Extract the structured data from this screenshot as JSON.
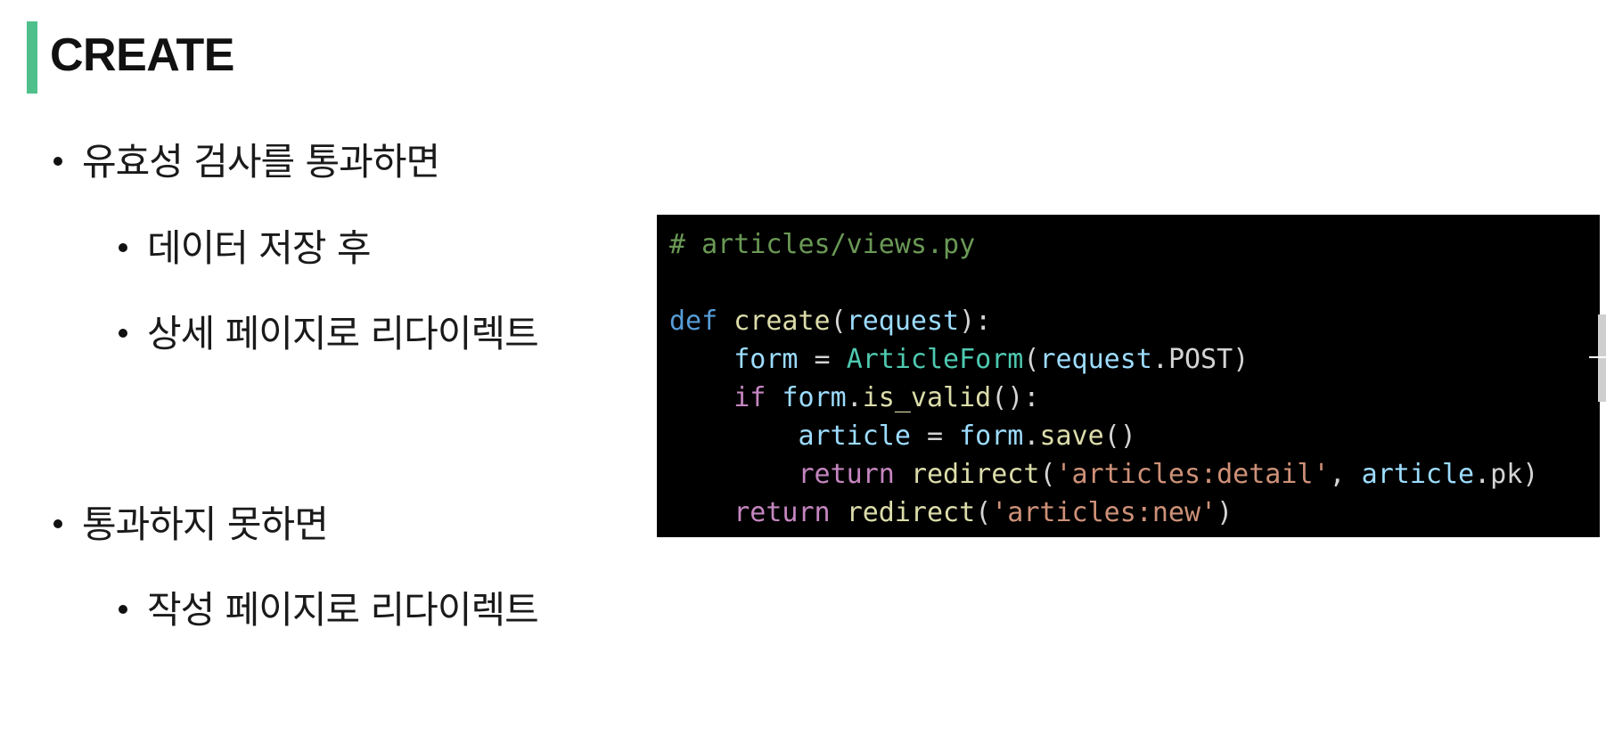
{
  "slide": {
    "title": "CREATE",
    "accent_color": "#4fbf8c"
  },
  "bullets": [
    {
      "level": 1,
      "text": "유효성 검사를 통과하면"
    },
    {
      "level": 2,
      "text": "데이터 저장 후"
    },
    {
      "level": 2,
      "text": "상세 페이지로 리다이렉트"
    },
    {
      "level": 1,
      "text": "통과하지 못하면"
    },
    {
      "level": 2,
      "text": "작성 페이지로 리다이렉트"
    }
  ],
  "code": {
    "background": "#000000",
    "line1": {
      "comment": "# articles/views.py"
    },
    "line3": {
      "kw_def": "def",
      "fn": "create",
      "p1": "(",
      "arg": "request",
      "p2": "):"
    },
    "line4": {
      "indent": "    ",
      "var": "form",
      "op": " = ",
      "cls": "ArticleForm",
      "p1": "(",
      "arg": "request",
      "dot": ".",
      "attr": "POST",
      "p2": ")"
    },
    "line5": {
      "indent": "    ",
      "kw": "if",
      "sp": " ",
      "var": "form",
      "dot": ".",
      "fn": "is_valid",
      "p": "():"
    },
    "line6": {
      "indent": "        ",
      "var": "article",
      "op": " = ",
      "obj": "form",
      "dot": ".",
      "fn": "save",
      "p": "()"
    },
    "line7": {
      "indent": "        ",
      "kw": "return",
      "sp": " ",
      "fn": "redirect",
      "p1": "(",
      "str": "'articles:detail'",
      "comma": ", ",
      "var": "article",
      "dot": ".",
      "attr": "pk",
      "p2": ")"
    },
    "line8": {
      "indent": "    ",
      "kw": "return",
      "sp": " ",
      "fn": "redirect",
      "p1": "(",
      "str": "'articles:new'",
      "p2": ")"
    }
  }
}
